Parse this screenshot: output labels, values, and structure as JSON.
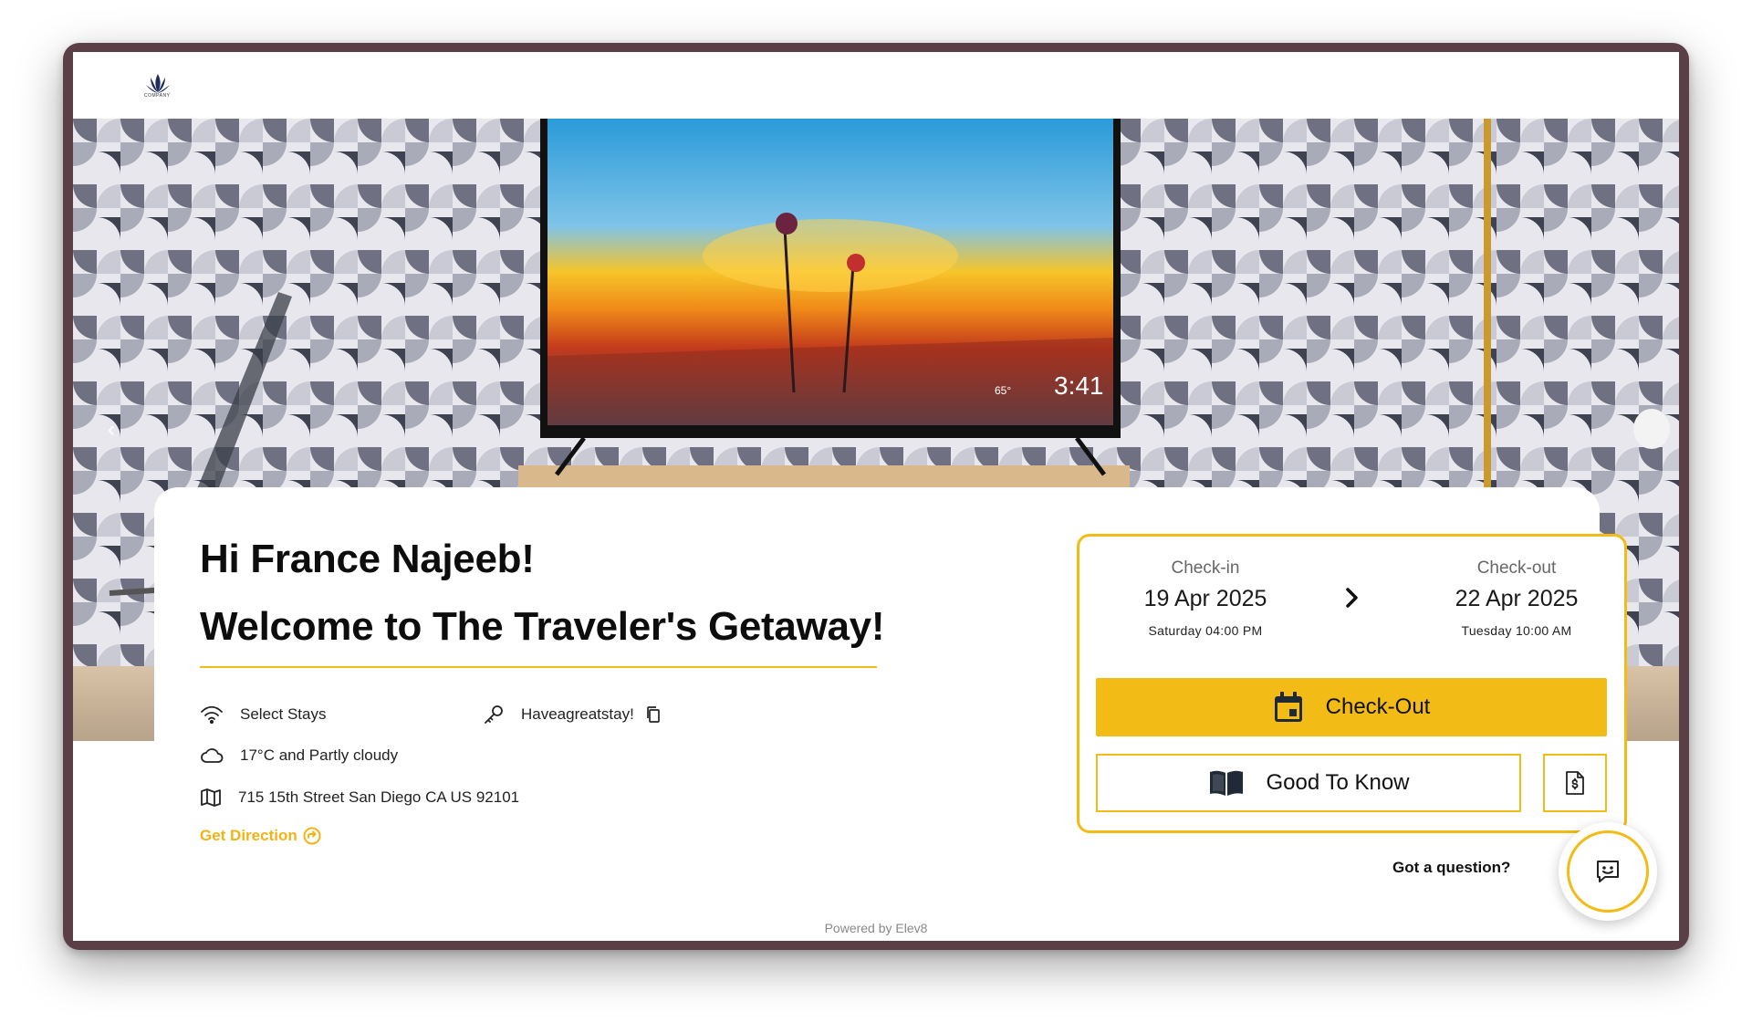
{
  "header": {
    "logo_text": "COMPANY"
  },
  "hero": {
    "tv_temp": "65°",
    "tv_time": "3:41"
  },
  "greeting": "Hi France Najeeb!",
  "welcome": "Welcome to The Traveler's Getaway!",
  "info": {
    "wifi": "Select Stays",
    "password": "Haveagreatstay!",
    "weather": "17°C and Partly cloudy",
    "address": "715 15th Street San Diego CA US 92101",
    "directions": "Get Direction"
  },
  "booking": {
    "checkin_label": "Check-in",
    "checkin_date": "19 Apr 2025",
    "checkin_time": "Saturday 04:00 PM",
    "checkout_label": "Check-out",
    "checkout_date": "22 Apr 2025",
    "checkout_time": "Tuesday 10:00 AM",
    "checkout_button": "Check-Out",
    "good_to_know_button": "Good To Know"
  },
  "chat": {
    "question": "Got a question?"
  },
  "footer": {
    "powered": "Powered by Elev8"
  },
  "colors": {
    "accent": "#f2bb16",
    "frame": "#5a3f46"
  }
}
